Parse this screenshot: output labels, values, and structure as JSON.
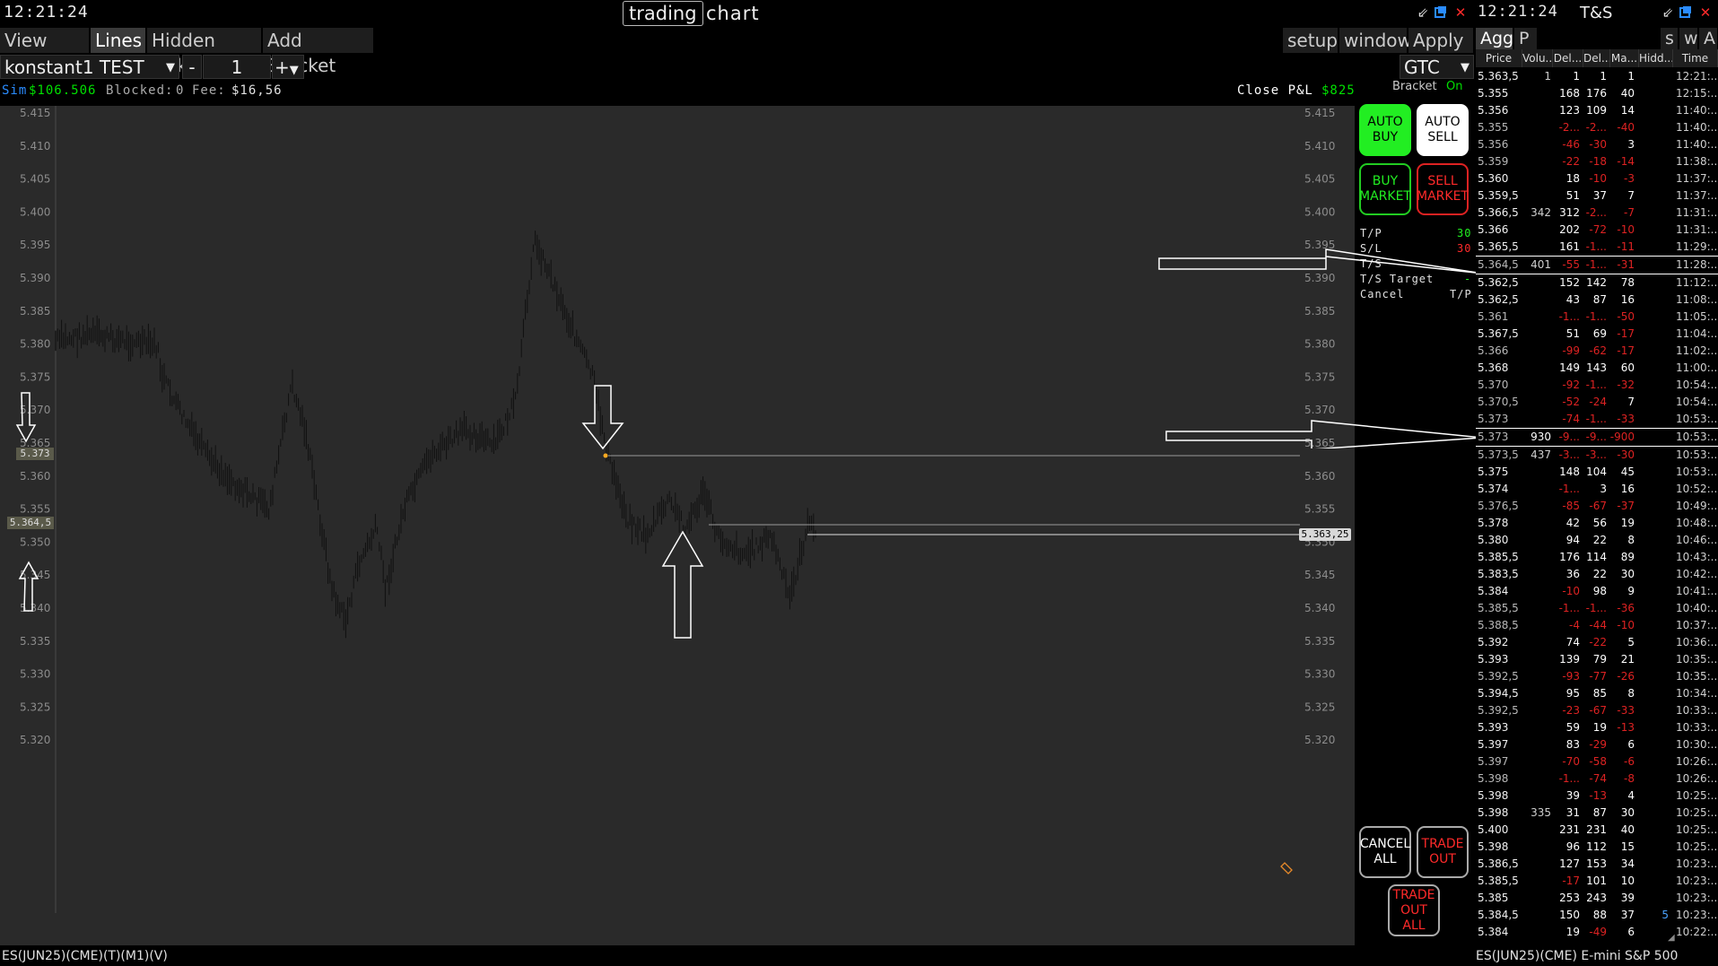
{
  "chart_window": {
    "clock": "12:21:24",
    "title_main": "trading",
    "title_rest": "chart",
    "toolbar": {
      "left": [
        "View DoM",
        "Lines",
        "Hidden Ticks",
        "Add Bracket"
      ],
      "active": "Lines",
      "right": [
        "setup",
        "window",
        "Apply"
      ]
    },
    "account": "konstant1 TEST",
    "qty_minus": "-",
    "qty": "1",
    "qty_plus": "+",
    "tif": "GTC",
    "status": {
      "sim": "Sim",
      "balance": "$106.506",
      "blocked_label": "Blocked:",
      "blocked": "0",
      "fee_label": "Fee:",
      "fee": "$16,56",
      "close_pnl_label": "Close P&L",
      "close_pnl": "$825",
      "bracket_label": "Bracket",
      "bracket_state": "On"
    },
    "price_axis": [
      "5.415",
      "5.410",
      "5.405",
      "5.400",
      "5.395",
      "5.390",
      "5.385",
      "5.380",
      "5.375",
      "5.370",
      "5.365",
      "5.360",
      "5.355",
      "5.350",
      "5.345",
      "5.340",
      "5.335",
      "5.330",
      "5.325",
      "5.320"
    ],
    "price_tags": {
      "left_top": "5.373",
      "left_bottom": "5.364,5",
      "right": "5.363,25"
    },
    "trade_panel": {
      "auto_buy": "AUTO\nBUY",
      "auto_sell": "AUTO\nSELL",
      "buy_market": "BUY\nMARKET",
      "sell_market": "SELL\nMARKET",
      "tp_label": "T/P",
      "tp_value": "30",
      "sl_label": "S/L",
      "sl_value": "30",
      "ts_label": "T/S",
      "ts_target_label": "T/S Target",
      "ts_target_value": "-",
      "cancel_label": "Cancel",
      "cancel_value": "T/P",
      "cancel_all": "CANCEL\nALL",
      "trade_out": "TRADE\nOUT",
      "trade_out_all": "TRADE\nOUT\nALL"
    },
    "footer": "ES(JUN25)(CME)(T)(M1)(V)",
    "colors": {
      "green": "#00e000",
      "red": "#e00000",
      "plot_bg": "#2a2a2a"
    }
  },
  "ts_window": {
    "clock": "12:21:24",
    "title": "T&S",
    "tabs": [
      "Agg",
      "P"
    ],
    "tabs_right": [
      "s",
      "w",
      "A"
    ],
    "columns": [
      "Price",
      "Volu...",
      "Del...",
      "Del...",
      "Ma...",
      "Hidd...",
      "Time"
    ],
    "rows": [
      {
        "price": "5.363,5",
        "vol": "1",
        "d1": "1",
        "d2": "1",
        "ma": "1",
        "hid": "",
        "time": "12:21:...",
        "c": "w"
      },
      {
        "price": "5.355",
        "vol": "",
        "d1": "168",
        "d2": "176",
        "ma": "40",
        "hid": "",
        "time": "12:15:...",
        "c": "w"
      },
      {
        "price": "5.356",
        "vol": "",
        "d1": "123",
        "d2": "109",
        "ma": "14",
        "hid": "",
        "time": "11:40:...",
        "c": "w"
      },
      {
        "price": "5.355",
        "vol": "",
        "d1": "-2...",
        "d2": "-2...",
        "ma": "-40",
        "hid": "",
        "time": "11:40:...",
        "c": "r"
      },
      {
        "price": "5.356",
        "vol": "",
        "d1": "-46",
        "d2": "-30",
        "ma": "3",
        "hid": "",
        "time": "11:40:...",
        "c": "r"
      },
      {
        "price": "5.359",
        "vol": "",
        "d1": "-22",
        "d2": "-18",
        "ma": "-14",
        "hid": "",
        "time": "11:38:...",
        "c": "r"
      },
      {
        "price": "5.360",
        "vol": "",
        "d1": "18",
        "d2": "-10",
        "ma": "-3",
        "hid": "",
        "time": "11:37:...",
        "c": "m"
      },
      {
        "price": "5.359,5",
        "vol": "",
        "d1": "51",
        "d2": "37",
        "ma": "7",
        "hid": "",
        "time": "11:37:...",
        "c": "w"
      },
      {
        "price": "5.366,5",
        "vol": "342",
        "d1": "312",
        "d2": "-2...",
        "ma": "-7",
        "hid": "",
        "time": "11:31:...",
        "c": "m"
      },
      {
        "price": "5.366",
        "vol": "",
        "d1": "202",
        "d2": "-72",
        "ma": "-10",
        "hid": "",
        "time": "11:31:...",
        "c": "m"
      },
      {
        "price": "5.365,5",
        "vol": "",
        "d1": "161",
        "d2": "-1...",
        "ma": "-11",
        "hid": "",
        "time": "11:29:...",
        "c": "m"
      },
      {
        "price": "5.364,5",
        "vol": "401",
        "d1": "-55",
        "d2": "-1...",
        "ma": "-31",
        "hid": "",
        "time": "11:28:...",
        "c": "r",
        "hl": true
      },
      {
        "price": "5.362,5",
        "vol": "",
        "d1": "152",
        "d2": "142",
        "ma": "78",
        "hid": "",
        "time": "11:12:...",
        "c": "w"
      },
      {
        "price": "5.362,5",
        "vol": "",
        "d1": "43",
        "d2": "87",
        "ma": "16",
        "hid": "",
        "time": "11:08:...",
        "c": "w"
      },
      {
        "price": "5.361",
        "vol": "",
        "d1": "-1...",
        "d2": "-1...",
        "ma": "-50",
        "hid": "",
        "time": "11:05:...",
        "c": "r"
      },
      {
        "price": "5.367,5",
        "vol": "",
        "d1": "51",
        "d2": "69",
        "ma": "-17",
        "hid": "",
        "time": "11:04:...",
        "c": "m"
      },
      {
        "price": "5.366",
        "vol": "",
        "d1": "-99",
        "d2": "-62",
        "ma": "-17",
        "hid": "",
        "time": "11:02:...",
        "c": "r"
      },
      {
        "price": "5.368",
        "vol": "",
        "d1": "149",
        "d2": "143",
        "ma": "60",
        "hid": "",
        "time": "11:00:...",
        "c": "w"
      },
      {
        "price": "5.370",
        "vol": "",
        "d1": "-92",
        "d2": "-1...",
        "ma": "-32",
        "hid": "",
        "time": "10:54:...",
        "c": "r"
      },
      {
        "price": "5.370,5",
        "vol": "",
        "d1": "-52",
        "d2": "-24",
        "ma": "7",
        "hid": "",
        "time": "10:54:...",
        "c": "r"
      },
      {
        "price": "5.373",
        "vol": "",
        "d1": "-74",
        "d2": "-1...",
        "ma": "-33",
        "hid": "",
        "time": "10:53:...",
        "c": "r"
      },
      {
        "price": "5.373",
        "vol": "930",
        "d1": "-9...",
        "d2": "-9...",
        "ma": "-900",
        "hid": "",
        "time": "10:53:...",
        "c": "r",
        "hl": true
      },
      {
        "price": "5.373,5",
        "vol": "437",
        "d1": "-3...",
        "d2": "-3...",
        "ma": "-30",
        "hid": "",
        "time": "10:53:...",
        "c": "r"
      },
      {
        "price": "5.375",
        "vol": "",
        "d1": "148",
        "d2": "104",
        "ma": "45",
        "hid": "",
        "time": "10:53:...",
        "c": "w"
      },
      {
        "price": "5.374",
        "vol": "",
        "d1": "-1...",
        "d2": "3",
        "ma": "16",
        "hid": "",
        "time": "10:52:...",
        "c": "m"
      },
      {
        "price": "5.376,5",
        "vol": "",
        "d1": "-85",
        "d2": "-67",
        "ma": "-37",
        "hid": "",
        "time": "10:49:...",
        "c": "r"
      },
      {
        "price": "5.378",
        "vol": "",
        "d1": "42",
        "d2": "56",
        "ma": "19",
        "hid": "",
        "time": "10:48:...",
        "c": "w"
      },
      {
        "price": "5.380",
        "vol": "",
        "d1": "94",
        "d2": "22",
        "ma": "8",
        "hid": "",
        "time": "10:46:...",
        "c": "w"
      },
      {
        "price": "5.385,5",
        "vol": "",
        "d1": "176",
        "d2": "114",
        "ma": "89",
        "hid": "",
        "time": "10:43:...",
        "c": "w"
      },
      {
        "price": "5.383,5",
        "vol": "",
        "d1": "36",
        "d2": "22",
        "ma": "30",
        "hid": "",
        "time": "10:42:...",
        "c": "w"
      },
      {
        "price": "5.384",
        "vol": "",
        "d1": "-10",
        "d2": "98",
        "ma": "9",
        "hid": "",
        "time": "10:41:...",
        "c": "m"
      },
      {
        "price": "5.385,5",
        "vol": "",
        "d1": "-1...",
        "d2": "-1...",
        "ma": "-36",
        "hid": "",
        "time": "10:40:...",
        "c": "r"
      },
      {
        "price": "5.388,5",
        "vol": "",
        "d1": "-4",
        "d2": "-44",
        "ma": "-10",
        "hid": "",
        "time": "10:37:...",
        "c": "r"
      },
      {
        "price": "5.392",
        "vol": "",
        "d1": "74",
        "d2": "-22",
        "ma": "5",
        "hid": "",
        "time": "10:36:...",
        "c": "m"
      },
      {
        "price": "5.393",
        "vol": "",
        "d1": "139",
        "d2": "79",
        "ma": "21",
        "hid": "",
        "time": "10:35:...",
        "c": "w"
      },
      {
        "price": "5.392,5",
        "vol": "",
        "d1": "-93",
        "d2": "-77",
        "ma": "-26",
        "hid": "",
        "time": "10:35:...",
        "c": "r"
      },
      {
        "price": "5.394,5",
        "vol": "",
        "d1": "95",
        "d2": "85",
        "ma": "8",
        "hid": "",
        "time": "10:34:...",
        "c": "w"
      },
      {
        "price": "5.392,5",
        "vol": "",
        "d1": "-23",
        "d2": "-67",
        "ma": "-33",
        "hid": "",
        "time": "10:33:...",
        "c": "r"
      },
      {
        "price": "5.393",
        "vol": "",
        "d1": "59",
        "d2": "19",
        "ma": "-13",
        "hid": "",
        "time": "10:33:...",
        "c": "m"
      },
      {
        "price": "5.397",
        "vol": "",
        "d1": "83",
        "d2": "-29",
        "ma": "6",
        "hid": "",
        "time": "10:30:...",
        "c": "m"
      },
      {
        "price": "5.397",
        "vol": "",
        "d1": "-70",
        "d2": "-58",
        "ma": "-6",
        "hid": "",
        "time": "10:26:...",
        "c": "r"
      },
      {
        "price": "5.398",
        "vol": "",
        "d1": "-1...",
        "d2": "-74",
        "ma": "-8",
        "hid": "",
        "time": "10:26:...",
        "c": "r"
      },
      {
        "price": "5.398",
        "vol": "",
        "d1": "39",
        "d2": "-13",
        "ma": "4",
        "hid": "",
        "time": "10:25:...",
        "c": "m"
      },
      {
        "price": "5.398",
        "vol": "335",
        "d1": "31",
        "d2": "87",
        "ma": "30",
        "hid": "",
        "time": "10:25:...",
        "c": "w"
      },
      {
        "price": "5.400",
        "vol": "",
        "d1": "231",
        "d2": "231",
        "ma": "40",
        "hid": "",
        "time": "10:25:...",
        "c": "w"
      },
      {
        "price": "5.398",
        "vol": "",
        "d1": "96",
        "d2": "112",
        "ma": "15",
        "hid": "",
        "time": "10:25:...",
        "c": "w"
      },
      {
        "price": "5.386,5",
        "vol": "",
        "d1": "127",
        "d2": "153",
        "ma": "34",
        "hid": "",
        "time": "10:23:...",
        "c": "w"
      },
      {
        "price": "5.385,5",
        "vol": "",
        "d1": "-17",
        "d2": "101",
        "ma": "10",
        "hid": "",
        "time": "10:23:...",
        "c": "m"
      },
      {
        "price": "5.385",
        "vol": "",
        "d1": "253",
        "d2": "243",
        "ma": "39",
        "hid": "",
        "time": "10:23:...",
        "c": "w"
      },
      {
        "price": "5.384,5",
        "vol": "",
        "d1": "150",
        "d2": "88",
        "ma": "37",
        "hid": "5",
        "time": "10:23:...",
        "c": "w"
      },
      {
        "price": "5.384",
        "vol": "",
        "d1": "19",
        "d2": "-49",
        "ma": "6",
        "hid": "",
        "time": "10:22:...",
        "c": "m"
      }
    ],
    "footer": "ES(JUN25)(CME) E-mini S&P 500"
  }
}
